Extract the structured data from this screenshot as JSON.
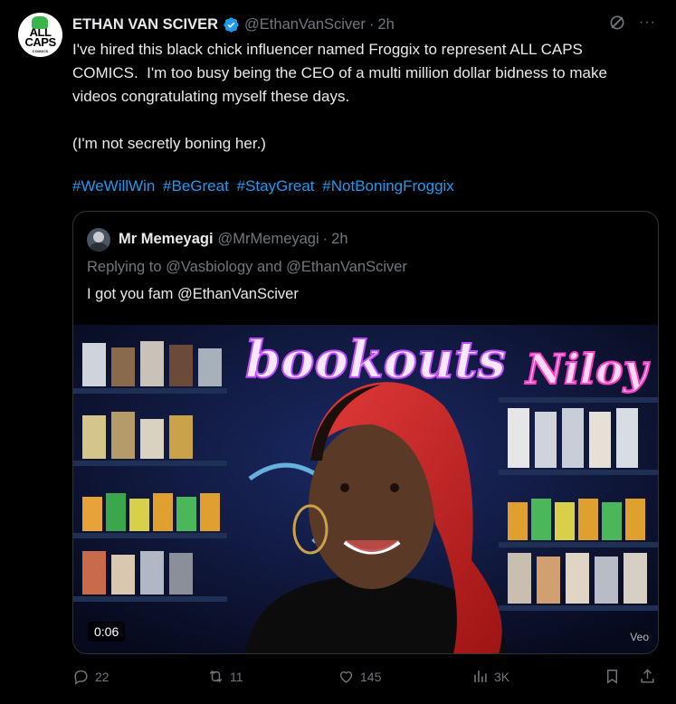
{
  "tweet": {
    "author": {
      "display_name": "ETHAN VAN SCIVER",
      "handle": "@EthanVanSciver",
      "avatar_text": "ALL CAPS",
      "avatar_subtext": "COMICS"
    },
    "separator": "·",
    "time": "2h",
    "text": "I've hired this black chick influencer named Froggix to represent ALL CAPS COMICS.  I'm too busy being the CEO of a multi million dollar bidness to make videos congratulating myself these days.\n\n(I'm not secretly boning her.)",
    "hashtags": [
      "#WeWillWin",
      "#BeGreat",
      "#StayGreat",
      "#NotBoningFroggix"
    ],
    "more_label": "···"
  },
  "quote": {
    "display_name": "Mr Memeyagi",
    "handle": "@MrMemeyagi",
    "separator": "·",
    "time": "2h",
    "replying_to": "Replying to @Vasbiology and @EthanVanSciver",
    "text": "I got you fam @EthanVanSciver",
    "video": {
      "duration": "0:06",
      "watermark": "Veo",
      "neon_left": "bookouts",
      "neon_right": "Niloy"
    }
  },
  "actions": {
    "replies": "22",
    "reposts": "11",
    "likes": "145",
    "views": "3K"
  },
  "icons": [
    "verified-icon",
    "grok-icon",
    "more-icon",
    "reply-icon",
    "repost-icon",
    "like-icon",
    "views-icon",
    "bookmark-icon",
    "share-icon"
  ],
  "colors": {
    "accent": "#1d9bf0",
    "muted": "#71767b",
    "text": "#e7e9ea",
    "border": "#2f3336"
  }
}
